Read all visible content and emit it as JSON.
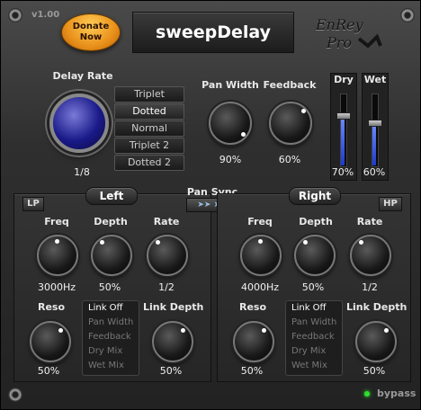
{
  "version": "v1.00",
  "donate_label_1": "Donate",
  "donate_label_2": "Now",
  "title": "sweepDelay",
  "logo_text": "EnRey Pro",
  "delay": {
    "label": "Delay Rate",
    "value": "1/8",
    "options": [
      "Triplet",
      "Dotted",
      "Normal",
      "Triplet 2",
      "Dotted 2"
    ],
    "selected": "Dotted"
  },
  "pan_width": {
    "label": "Pan Width",
    "value": "90%"
  },
  "feedback": {
    "label": "Feedback",
    "value": "60%"
  },
  "dry": {
    "label": "Dry",
    "value": "70%",
    "level": 0.7
  },
  "wet": {
    "label": "Wet",
    "value": "60%",
    "level": 0.6
  },
  "pan_sync": {
    "label": "Pan Sync",
    "arrows": "➤➤ ➤➤"
  },
  "left": {
    "title": "Left",
    "filter": "LP",
    "freq": {
      "label": "Freq",
      "value": "3000Hz"
    },
    "depth": {
      "label": "Depth",
      "value": "50%"
    },
    "rate": {
      "label": "Rate",
      "value": "1/2"
    },
    "reso": {
      "label": "Reso",
      "value": "50%"
    },
    "link_depth": {
      "label": "Link Depth",
      "value": "50%"
    },
    "link_items": [
      "Link Off",
      "Pan Width",
      "Feedback",
      "Dry Mix",
      "Wet Mix"
    ]
  },
  "right": {
    "title": "Right",
    "filter": "HP",
    "freq": {
      "label": "Freq",
      "value": "4000Hz"
    },
    "depth": {
      "label": "Depth",
      "value": "50%"
    },
    "rate": {
      "label": "Rate",
      "value": "1/2"
    },
    "reso": {
      "label": "Reso",
      "value": "50%"
    },
    "link_depth": {
      "label": "Link Depth",
      "value": "50%"
    },
    "link_items": [
      "Link Off",
      "Pan Width",
      "Feedback",
      "Dry Mix",
      "Wet Mix"
    ]
  },
  "bypass": "bypass",
  "colors": {
    "accent_blue": "#2a3ad0",
    "donate_orange": "#e8901a",
    "led_green": "#30e030"
  }
}
